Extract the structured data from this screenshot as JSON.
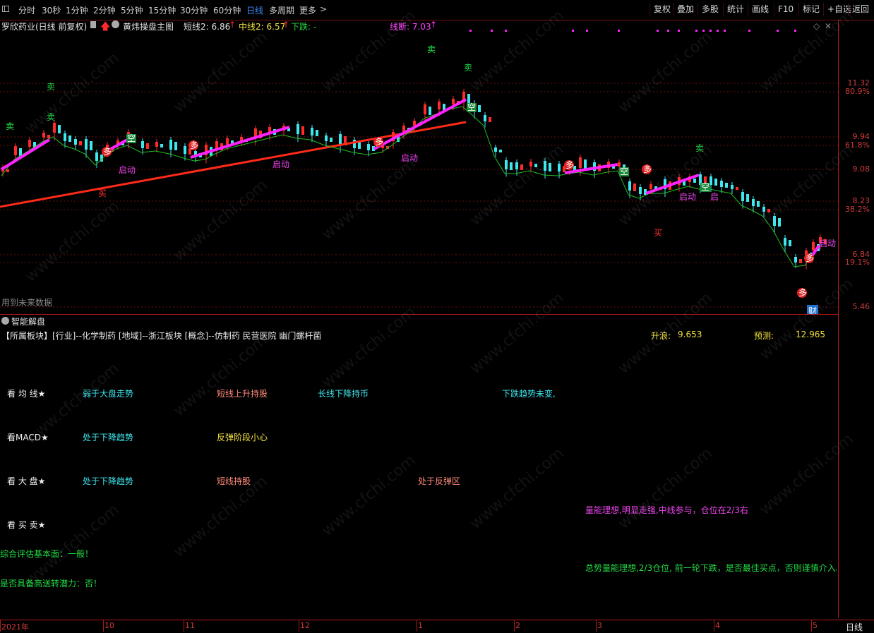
{
  "toolbar": {
    "periods": [
      "分时",
      "30秒",
      "1分钟",
      "2分钟",
      "5分钟",
      "15分钟",
      "30分钟",
      "60分钟",
      "日线",
      "多周期",
      "更多"
    ],
    "active_period": "日线",
    "more_arrow": ">",
    "right_buttons": [
      "复权",
      "叠加",
      "多股",
      "统计",
      "画线",
      "F10",
      "标记",
      "+自选",
      "返回"
    ]
  },
  "chart": {
    "stock_name": "罗欣药业(日线 前复权)",
    "indicator_name": "黄炜操盘主图",
    "short_line": "短线2: 6.86",
    "mid_line": "中线2: 6.57",
    "down_label": "下跌: -",
    "break_line": "线断: 7.03",
    "future_data": "用到未来数据",
    "axis_labels": [
      "11.32",
      "80.9%",
      "9.94",
      "61.8%",
      "9.08",
      "8.23",
      "38.2%",
      "6.84",
      "19.1%",
      "5.46"
    ],
    "signals": {
      "sell": "卖",
      "buy": "买",
      "start": "启动",
      "empty": "空",
      "more": "多",
      "cai": "财",
      "start_short": "启"
    }
  },
  "panel": {
    "title": "智能解盘",
    "sector_line": "【所属板块】[行业]--化学制药 [地域]--浙江板块 [概念]--仿制药 民营医院 幽门螺杆菌",
    "rise_label": "升浪:",
    "rise_value": "9.653",
    "predict_label": "预测:",
    "predict_value": "12.965",
    "rows": [
      {
        "head": "看 均 线★",
        "a": "弱于大盘走势",
        "b": "短线上升持股",
        "c": "长线下降持币",
        "d": "下跌趋势未变,"
      },
      {
        "head": "看MACD★",
        "a": "处于下降趋势",
        "b": "反弹阶段小心"
      },
      {
        "head": "看 大 盘★",
        "a": "处于下降趋势",
        "b": "短线持股",
        "c": "处于反弹区"
      },
      {
        "head": "看 买 卖★"
      }
    ],
    "volume_note": "量能理想,明显走强,中线参与，仓位在2/3右",
    "fundamental": "综合评估基本面：一般！",
    "trend_note": "总势量能理想,2/3仓位, 前一轮下跌，是否最佳买点，否则谨慎介入。",
    "high_transfer": "是否具备高送转潜力：否！"
  },
  "date_axis": {
    "labels": [
      "2021年",
      "10",
      "11",
      "12",
      "1",
      "2",
      "3",
      "4",
      "5"
    ],
    "period": "日线"
  },
  "watermark": "www.cfchi.com",
  "colors": {
    "up": "#ff2a2a",
    "down": "#3ee6ee",
    "grid": "#7a1010",
    "magenta": "#ff22ff",
    "green": "#22dd44"
  }
}
